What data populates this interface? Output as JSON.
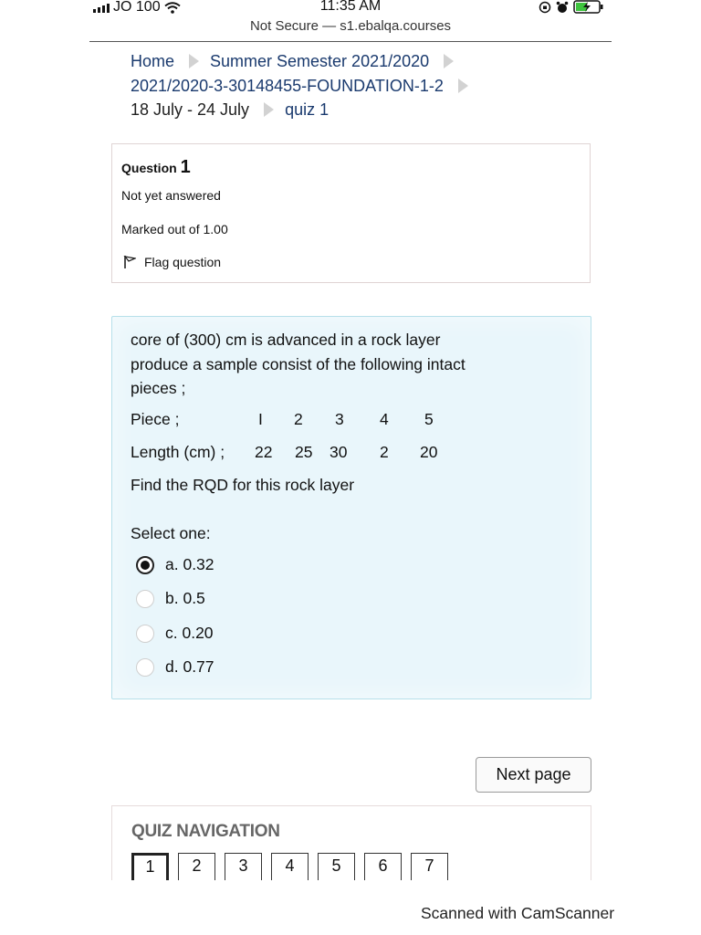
{
  "status_bar": {
    "carrier": "JO 100",
    "time": "11:35 AM",
    "address": "Not Secure — s1.ebalqa.courses",
    "icons": [
      "signal-icon",
      "wifi-icon",
      "orientation-lock-icon",
      "alarm-icon",
      "battery-charging-icon"
    ]
  },
  "breadcrumb": {
    "home": "Home",
    "semester": "Summer Semester 2021/2020",
    "course": "2021/2020-3-30148455-FOUNDATION-1-2",
    "week": "18 July - 24 July",
    "quiz": "quiz 1"
  },
  "question_info": {
    "label": "Question",
    "number": "1",
    "state": "Not yet answered",
    "marked": "Marked out of 1.00",
    "flag": "Flag question"
  },
  "question": {
    "line1": "core of (300) cm is advanced in a rock layer",
    "line2": "produce  a sample consist of the following intact",
    "line3": "pieces ;",
    "piece_label": "Piece ;",
    "pieces": [
      "I",
      "2",
      "3",
      "4",
      "5"
    ],
    "length_label": "Length (cm) ;",
    "lengths": [
      "22",
      "25",
      "30",
      "2",
      "20"
    ],
    "prompt": "Find the RQD for this rock layer",
    "select_one": "Select one:",
    "options": [
      {
        "label": "a. 0.32",
        "selected": true
      },
      {
        "label": "b. 0.5",
        "selected": false
      },
      {
        "label": "c. 0.20",
        "selected": false
      },
      {
        "label": "d. 0.77",
        "selected": false
      }
    ]
  },
  "next_page": "Next page",
  "quiz_nav": {
    "title": "QUIZ NAVIGATION",
    "pages": [
      "1",
      "2",
      "3",
      "4",
      "5",
      "6",
      "7"
    ],
    "current": "1"
  },
  "footer": "Scanned with CamScanner"
}
